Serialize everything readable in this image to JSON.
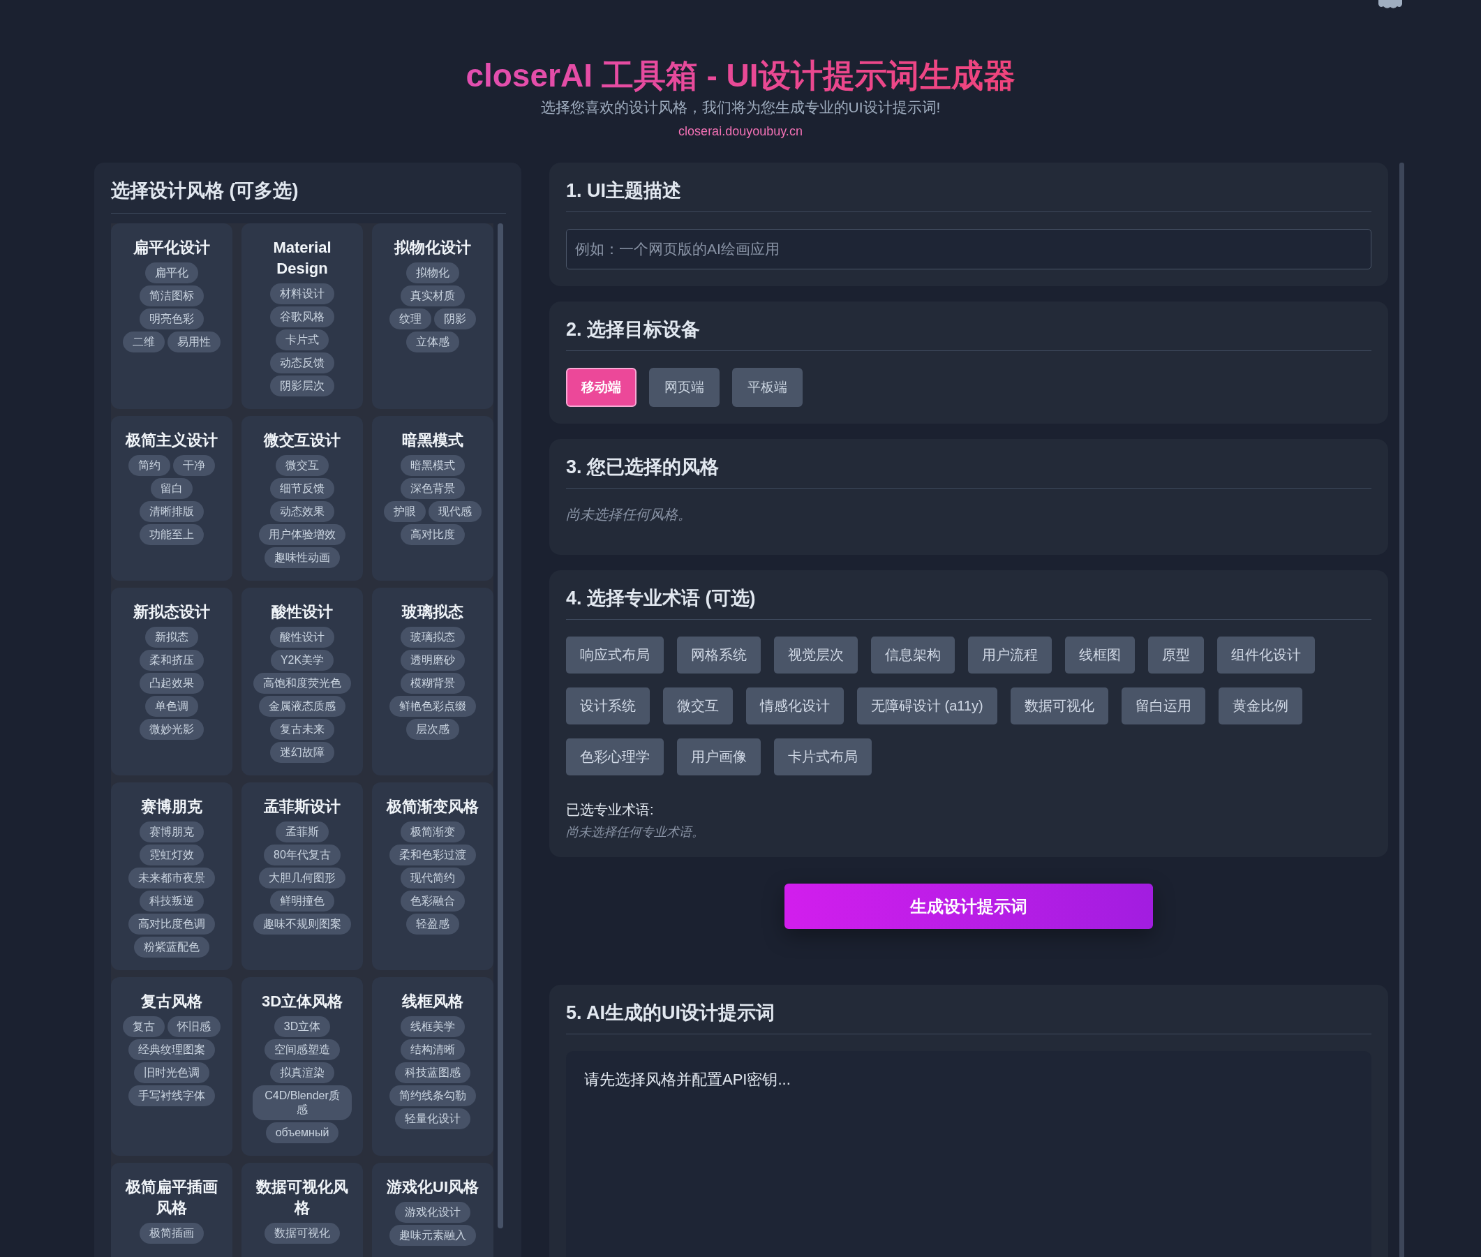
{
  "header": {
    "title": "closerAI 工具箱 - UI设计提示词生成器",
    "subtitle": "选择您喜欢的设计风格，我们将为您生成专业的UI设计提示词!",
    "url": "closerai.douyoubuy.cn"
  },
  "styles_panel": {
    "title": "选择设计风格 (可多选)",
    "cards": [
      {
        "title": "扁平化设计",
        "selected": false,
        "tags": [
          "扁平化",
          "简洁图标",
          "明亮色彩",
          "二维",
          "易用性"
        ]
      },
      {
        "title": "Material Design",
        "selected": false,
        "tags": [
          "材料设计",
          "谷歌风格",
          "卡片式",
          "动态反馈",
          "阴影层次"
        ]
      },
      {
        "title": "拟物化设计",
        "selected": false,
        "tags": [
          "拟物化",
          "真实材质",
          "纹理",
          "阴影",
          "立体感"
        ]
      },
      {
        "title": "极简主义设计",
        "selected": false,
        "tags": [
          "简约",
          "干净",
          "留白",
          "清晰排版",
          "功能至上"
        ]
      },
      {
        "title": "微交互设计",
        "selected": false,
        "tags": [
          "微交互",
          "细节反馈",
          "动态效果",
          "用户体验增效",
          "趣味性动画"
        ]
      },
      {
        "title": "暗黑模式",
        "selected": false,
        "tags": [
          "暗黑模式",
          "深色背景",
          "护眼",
          "现代感",
          "高对比度"
        ]
      },
      {
        "title": "新拟态设计",
        "selected": false,
        "tags": [
          "新拟态",
          "柔和挤压",
          "凸起效果",
          "单色调",
          "微妙光影"
        ]
      },
      {
        "title": "酸性设计",
        "selected": false,
        "tags": [
          "酸性设计",
          "Y2K美学",
          "高饱和度荧光色",
          "金属液态质感",
          "复古未来",
          "迷幻故障"
        ]
      },
      {
        "title": "玻璃拟态",
        "selected": false,
        "tags": [
          "玻璃拟态",
          "透明磨砂",
          "模糊背景",
          "鲜艳色彩点缀",
          "层次感"
        ]
      },
      {
        "title": "赛博朋克",
        "selected": false,
        "tags": [
          "赛博朋克",
          "霓虹灯效",
          "未来都市夜景",
          "科技叛逆",
          "高对比度色调",
          "粉紫蓝配色"
        ]
      },
      {
        "title": "孟菲斯设计",
        "selected": false,
        "tags": [
          "孟菲斯",
          "80年代复古",
          "大胆几何图形",
          "鲜明撞色",
          "趣味不规则图案"
        ]
      },
      {
        "title": "极简渐变风格",
        "selected": false,
        "tags": [
          "极简渐变",
          "柔和色彩过渡",
          "现代简约",
          "色彩融合",
          "轻盈感"
        ]
      },
      {
        "title": "复古风格",
        "selected": false,
        "tags": [
          "复古",
          "怀旧感",
          "经典纹理图案",
          "旧时光色调",
          "手写衬线字体"
        ]
      },
      {
        "title": "3D立体风格",
        "selected": false,
        "tags": [
          "3D立体",
          "空间感塑造",
          "拟真渲染",
          "C4D/Blender质感",
          "объемный"
        ]
      },
      {
        "title": "线框风格",
        "selected": false,
        "tags": [
          "线框美学",
          "结构清晰",
          "科技蓝图感",
          "简约线条勾勒",
          "轻量化设计"
        ]
      },
      {
        "title": "极简扁平插画风格",
        "selected": false,
        "tags": [
          "极简插画"
        ]
      },
      {
        "title": "数据可视化风格",
        "selected": false,
        "tags": [
          "数据可视化"
        ]
      },
      {
        "title": "游戏化UI风格",
        "selected": false,
        "tags": [
          "游戏化设计",
          "趣味元素融入"
        ]
      }
    ]
  },
  "theme_section": {
    "title": "1. UI主题描述",
    "placeholder": "例如：一个网页版的AI绘画应用"
  },
  "device_section": {
    "title": "2. 选择目标设备",
    "devices": [
      {
        "label": "移动端",
        "selected": true
      },
      {
        "label": "网页端",
        "selected": false
      },
      {
        "label": "平板端",
        "selected": false
      }
    ]
  },
  "chosen_section": {
    "title": "3. 您已选择的风格",
    "empty_text": "尚未选择任何风格。"
  },
  "terms_section": {
    "title": "4. 选择专业术语 (可选)",
    "terms": [
      {
        "label": "响应式布局",
        "selected": false
      },
      {
        "label": "网格系统",
        "selected": false
      },
      {
        "label": "视觉层次",
        "selected": false
      },
      {
        "label": "信息架构",
        "selected": false
      },
      {
        "label": "用户流程",
        "selected": false
      },
      {
        "label": "线框图",
        "selected": false
      },
      {
        "label": "原型",
        "selected": false
      },
      {
        "label": "组件化设计",
        "selected": false
      },
      {
        "label": "设计系统",
        "selected": false
      },
      {
        "label": "微交互",
        "selected": false
      },
      {
        "label": "情感化设计",
        "selected": false
      },
      {
        "label": "无障碍设计 (a11y)",
        "selected": false
      },
      {
        "label": "数据可视化",
        "selected": false
      },
      {
        "label": "留白运用",
        "selected": false
      },
      {
        "label": "黄金比例",
        "selected": false
      },
      {
        "label": "色彩心理学",
        "selected": false
      },
      {
        "label": "用户画像",
        "selected": false
      },
      {
        "label": "卡片式布局",
        "selected": false
      }
    ],
    "selected_label": "已选专业术语:",
    "empty_text": "尚未选择任何专业术语。"
  },
  "generate_button": "生成设计提示词",
  "result_section": {
    "title": "5. AI生成的UI设计提示词",
    "output": "请先选择风格并配置API密钥..."
  }
}
